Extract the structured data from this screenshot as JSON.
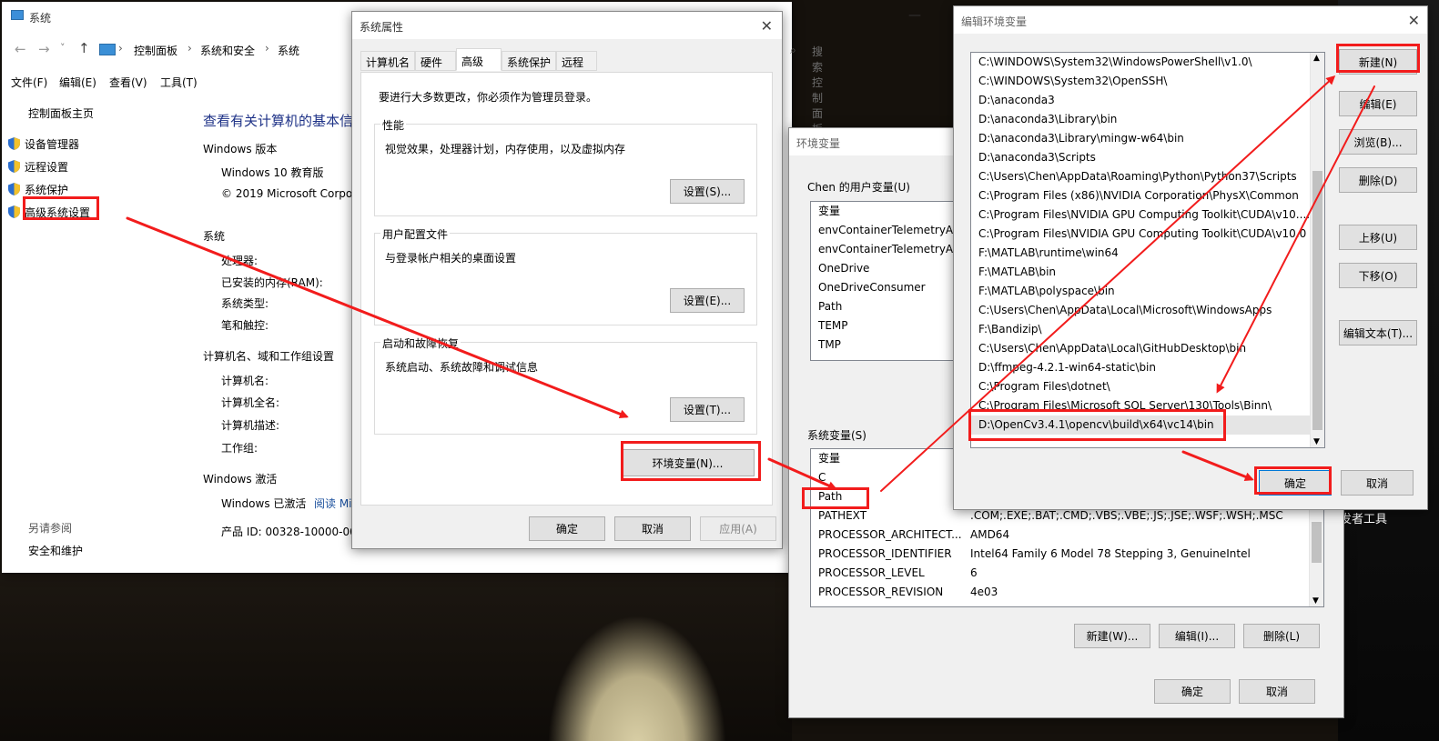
{
  "background": {
    "taskbar_text": "发者工具"
  },
  "sys": {
    "title": "系统",
    "breadcrumb": [
      "控制面板",
      "系统和安全",
      "系统"
    ],
    "search_placeholder": "搜索控制面板",
    "menu": [
      "文件(F)",
      "编辑(E)",
      "查看(V)",
      "工具(T)"
    ],
    "left": {
      "home": "控制面板主页",
      "links": [
        "设备管理器",
        "远程设置",
        "系统保护",
        "高级系统设置"
      ],
      "see_also": "另请参阅",
      "security": "安全和维护"
    },
    "heading": "查看有关计算机的基本信",
    "win_version_label": "Windows 版本",
    "edition": "Windows 10 教育版",
    "copyright": "© 2019 Microsoft Corpo",
    "system_label": "系统",
    "processor": "处理器:",
    "ram": "已安装的内存(RAM):",
    "systype": "系统类型:",
    "pen": "笔和触控:",
    "compname_label": "计算机名、域和工作组设置",
    "compname": "计算机名:",
    "fullname": "计算机全名:",
    "desc": "计算机描述:",
    "workgroup": "工作组:",
    "activation_label": "Windows 激活",
    "activated": "Windows 已激活",
    "readmore": "阅读 Mi",
    "product_id": "产品 ID: 00328-10000-000"
  },
  "props": {
    "title": "系统属性",
    "tabs": [
      "计算机名",
      "硬件",
      "高级",
      "系统保护",
      "远程"
    ],
    "admin_note": "要进行大多数更改，你必须作为管理员登录。",
    "perf": {
      "label": "性能",
      "desc": "视觉效果，处理器计划，内存使用，以及虚拟内存",
      "btn": "设置(S)..."
    },
    "profile": {
      "label": "用户配置文件",
      "desc": "与登录帐户相关的桌面设置",
      "btn": "设置(E)..."
    },
    "startup": {
      "label": "启动和故障恢复",
      "desc": "系统启动、系统故障和调试信息",
      "btn": "设置(T)..."
    },
    "env_btn": "环境变量(N)...",
    "ok": "确定",
    "cancel": "取消",
    "apply": "应用(A)"
  },
  "env": {
    "title": "环境变量",
    "user_label": "Chen 的用户变量(U)",
    "col_var": "变量",
    "user_vars": [
      "envContainerTelemetryAp...",
      "envContainerTelemetryAp...",
      "OneDrive",
      "OneDriveConsumer",
      "Path",
      "TEMP",
      "TMP"
    ],
    "sys_label": "系统变量(S)",
    "sys_vars": [
      {
        "name": "C",
        "value": ""
      },
      {
        "name": "Path",
        "value": ""
      },
      {
        "name": "PATHEXT",
        "value": ".COM;.EXE;.BAT;.CMD;.VBS;.VBE;.JS;.JSE;.WSF;.WSH;.MSC"
      },
      {
        "name": "PROCESSOR_ARCHITECT...",
        "value": "AMD64"
      },
      {
        "name": "PROCESSOR_IDENTIFIER",
        "value": "Intel64 Family 6 Model 78 Stepping 3, GenuineIntel"
      },
      {
        "name": "PROCESSOR_LEVEL",
        "value": "6"
      },
      {
        "name": "PROCESSOR_REVISION",
        "value": "4e03"
      }
    ],
    "new": "新建(W)...",
    "edit": "编辑(I)...",
    "del": "删除(L)",
    "ok": "确定",
    "cancel": "取消"
  },
  "edit": {
    "title": "编辑环境变量",
    "paths": [
      "C:\\WINDOWS\\System32\\WindowsPowerShell\\v1.0\\",
      "C:\\WINDOWS\\System32\\OpenSSH\\",
      "D:\\anaconda3",
      "D:\\anaconda3\\Library\\bin",
      "D:\\anaconda3\\Library\\mingw-w64\\bin",
      "D:\\anaconda3\\Scripts",
      "C:\\Users\\Chen\\AppData\\Roaming\\Python\\Python37\\Scripts",
      "C:\\Program Files (x86)\\NVIDIA Corporation\\PhysX\\Common",
      "C:\\Program Files\\NVIDIA GPU Computing Toolkit\\CUDA\\v10....",
      "C:\\Program Files\\NVIDIA GPU Computing Toolkit\\CUDA\\v10.0",
      "F:\\MATLAB\\runtime\\win64",
      "F:\\MATLAB\\bin",
      "F:\\MATLAB\\polyspace\\bin",
      "C:\\Users\\Chen\\AppData\\Local\\Microsoft\\WindowsApps",
      "F:\\Bandizip\\",
      "C:\\Users\\Chen\\AppData\\Local\\GitHubDesktop\\bin",
      "D:\\ffmpeg-4.2.1-win64-static\\bin",
      "C:\\Program Files\\dotnet\\",
      "C:\\Program Files\\Microsoft SQL Server\\130\\Tools\\Binn\\",
      "D:\\OpenCv3.4.1\\opencv\\build\\x64\\vc14\\bin"
    ],
    "buttons": {
      "new": "新建(N)",
      "edit": "编辑(E)",
      "browse": "浏览(B)...",
      "del": "删除(D)",
      "up": "上移(U)",
      "down": "下移(O)",
      "edittext": "编辑文本(T)..."
    },
    "ok": "确定",
    "cancel": "取消"
  },
  "colors": {
    "annotation": "#f21c1c",
    "link": "#1a4f9c"
  }
}
